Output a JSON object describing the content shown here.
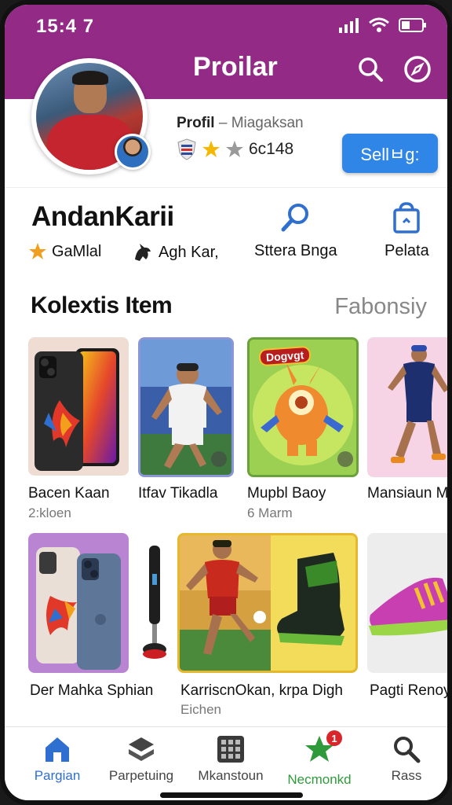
{
  "status_bar": {
    "time": "15:4 7"
  },
  "header": {
    "title": "Proilar"
  },
  "profile": {
    "label": "Profil",
    "subtitle": "– Miagaksan",
    "score": "6c148",
    "sell_button": "Sellㅂg:",
    "username": "AndanKarii",
    "stats": [
      {
        "icon": "star-icon",
        "label": "GaMlal"
      },
      {
        "icon": "griffin-icon",
        "label": "Agh Kar,"
      }
    ],
    "actions": [
      {
        "icon": "search-icon",
        "label": "Sttera Bnga"
      },
      {
        "icon": "bag-icon",
        "label": "Pelata"
      }
    ]
  },
  "collection": {
    "title": "Kolextis Item",
    "link": "Fabonsiy",
    "row1": [
      {
        "name": "Bacen Kaan",
        "sub": "2:kloen"
      },
      {
        "name": "Itfav Tikadla",
        "sub": ""
      },
      {
        "name": "Mupbl Baoy",
        "sub": "6 Marm",
        "card_tag": "Dogvgt"
      },
      {
        "name": "Mansiaun Mb",
        "sub": ""
      }
    ],
    "row2": [
      {
        "name": "Der Mahka Sphian",
        "sub": ""
      },
      {
        "name": "KarriscnOkan, krpa Digh",
        "sub": "Eichen"
      },
      {
        "name": "Pagti Renoy",
        "sub": ""
      }
    ]
  },
  "bottom_nav": [
    {
      "label": "Pargian",
      "icon": "home-icon",
      "active": true
    },
    {
      "label": "Parpetuing",
      "icon": "layers-icon"
    },
    {
      "label": "Mkanstoun",
      "icon": "grid-icon"
    },
    {
      "label": "Necmonkd",
      "icon": "star-icon",
      "badge": "1"
    },
    {
      "label": "Rass",
      "icon": "search-icon"
    }
  ],
  "colors": {
    "header": "#932a86",
    "accent": "#2f86e6",
    "nav_active": "#2f6fd0",
    "nav_green": "#2f9a3a"
  }
}
